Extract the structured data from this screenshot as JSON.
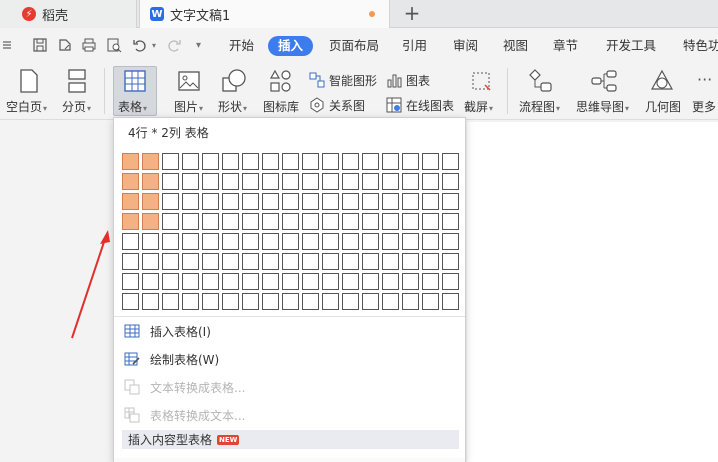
{
  "tabs": {
    "home_label": "稻壳",
    "home_icon_glyph": "⚡",
    "doc_label": "文字文稿1",
    "doc_icon_glyph": "W",
    "new_tab_glyph": "+"
  },
  "menus": {
    "dropdown_glyph": "▾",
    "items": [
      "开始",
      "插入",
      "页面布局",
      "引用",
      "审阅",
      "视图",
      "章节",
      "开发工具",
      "特色功"
    ],
    "active": "插入"
  },
  "ribbon": {
    "blank_page": "空白页",
    "page_break": "分页",
    "table": "表格",
    "picture": "图片",
    "shape": "形状",
    "icon_lib": "图标库",
    "smart_art": "智能图形",
    "relation_chart": "关系图",
    "chart": "图表",
    "online_chart": "在线图表",
    "screenshot": "截屏",
    "flowchart": "流程图",
    "mindmap": "思维导图",
    "geometry": "几何图",
    "more": "更多",
    "more_glyph": "···"
  },
  "table_popup": {
    "title": "4行 * 2列 表格",
    "selection": {
      "rows": 4,
      "cols": 2
    },
    "grid": {
      "rows": 8,
      "cols": 17
    },
    "insert_table": "插入表格(I)",
    "draw_table": "绘制表格(W)",
    "text_to_table": "文本转换成表格...",
    "table_to_text": "表格转换成文本...",
    "content_table": "插入内容型表格",
    "new_badge": "NEW"
  },
  "colors": {
    "accent": "#3d7ced",
    "selected_cell": "#f4b183",
    "annotation_arrow": "#e0302b"
  }
}
